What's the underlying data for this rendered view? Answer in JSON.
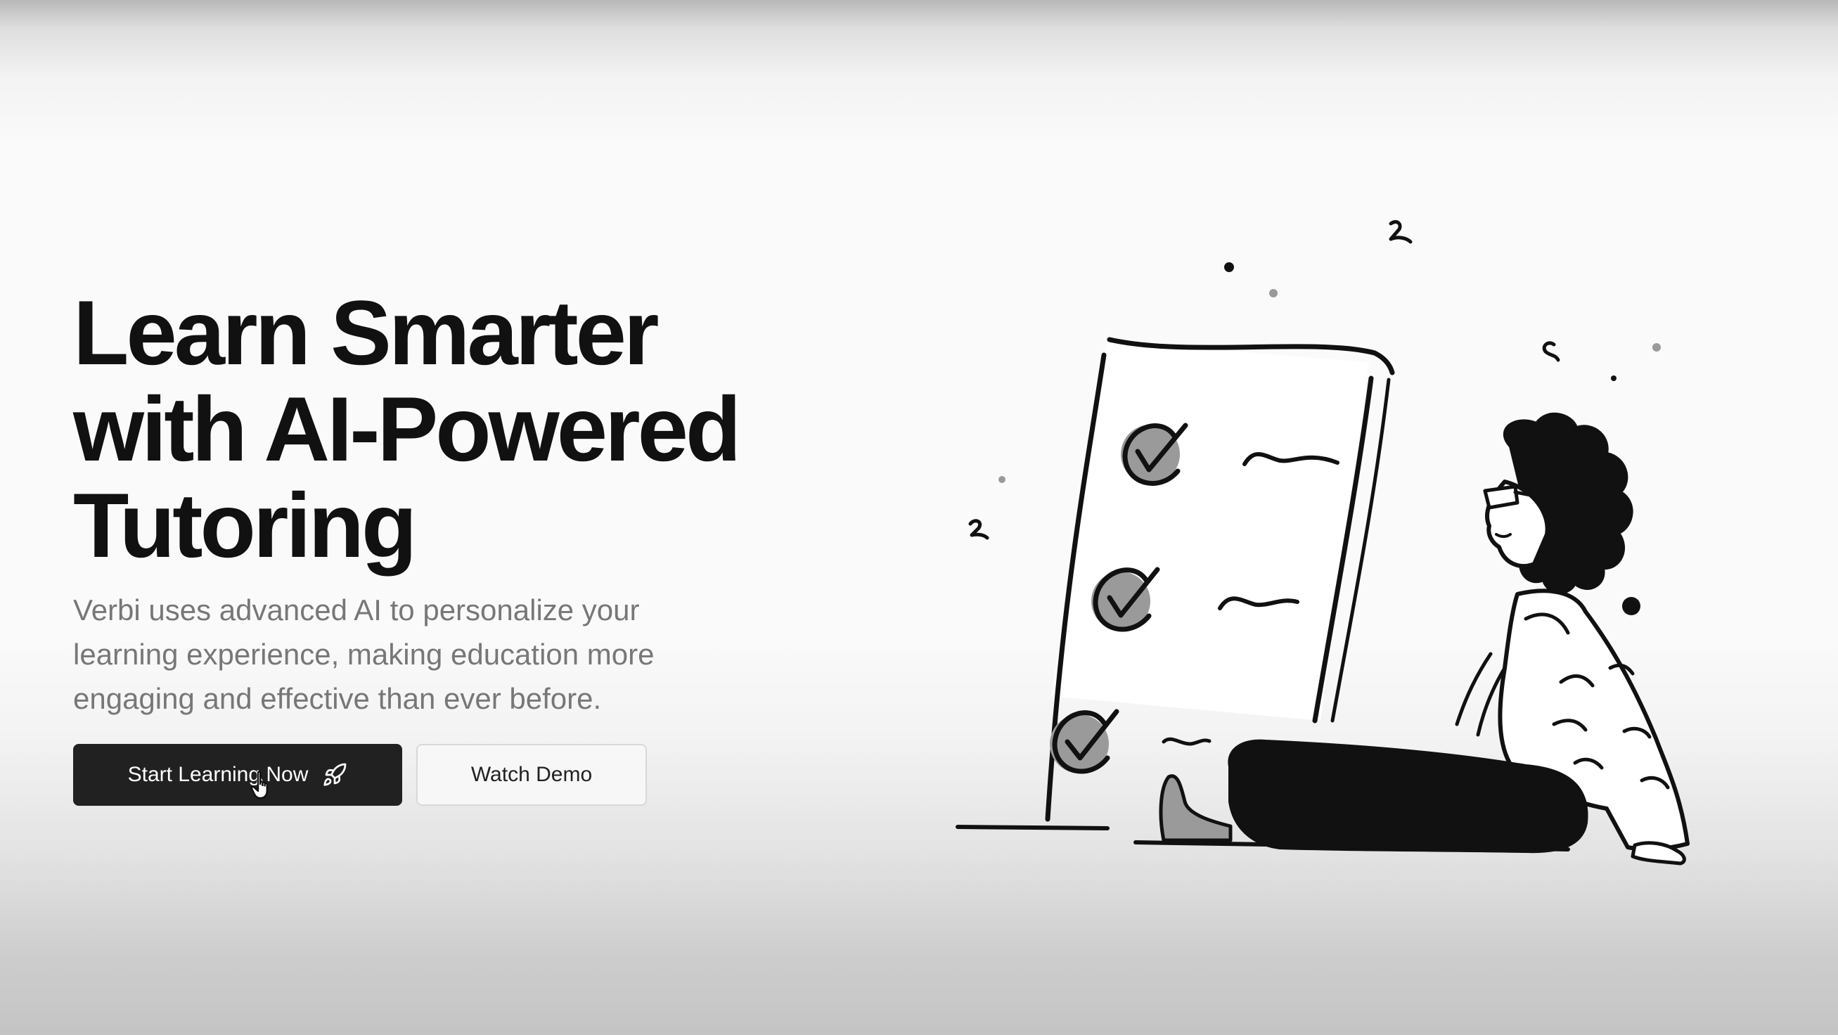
{
  "hero": {
    "title_lines": [
      "Learn Smarter",
      "with AI-Powered",
      "Tutoring"
    ],
    "subtitle": "Verbi uses advanced AI to personalize your learning experience, making education more engaging and effective than ever before.",
    "primary_cta": {
      "label": "Start Learning Now",
      "icon": "rocket-icon"
    },
    "secondary_cta": {
      "label": "Watch Demo"
    }
  },
  "illustration": {
    "description_icon": "checklist-person-illustration",
    "checklist_items": 3
  },
  "colors": {
    "primary_button": "#212121",
    "primary_text": "#111111",
    "subtitle_text": "#777777",
    "secondary_border": "#d8d8d8"
  }
}
